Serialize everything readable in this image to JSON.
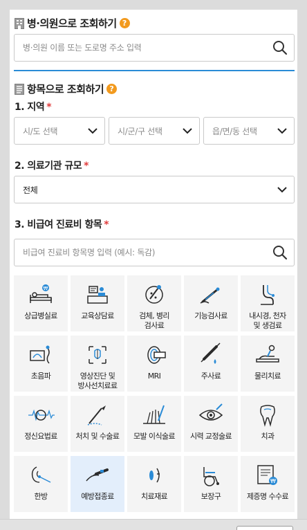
{
  "hospital_search": {
    "title": "병·의원으로 조회하기",
    "placeholder": "병·의원 이름 또는 도로명 주소 입력"
  },
  "item_search": {
    "title": "항목으로 조회하기"
  },
  "region": {
    "label": "1. 지역",
    "required": "*",
    "sido": "시/도 선택",
    "sigungu": "시/군/구 선택",
    "eupmyeondong": "읍/면/동 선택"
  },
  "scale": {
    "label": "2. 의료기관 규모",
    "required": "*",
    "value": "전체"
  },
  "items": {
    "label": "3. 비급여 진료비 항목",
    "required": "*",
    "placeholder": "비급여 진료비 항목명 입력 (예시: 독감)",
    "tiles": [
      {
        "label": "상급병실료",
        "icon": "hospital-bed-icon"
      },
      {
        "label": "교육상담료",
        "icon": "counseling-icon"
      },
      {
        "label": "검체, 병리\n검사료",
        "icon": "microscope-icon"
      },
      {
        "label": "기능검사료",
        "icon": "thermometer-icon"
      },
      {
        "label": "내시경, 천자\n및 생검료",
        "icon": "endoscope-icon"
      },
      {
        "label": "초음파",
        "icon": "ultrasound-icon"
      },
      {
        "label": "영상진단 및\n방사선치료료",
        "icon": "radiology-icon"
      },
      {
        "label": "MRI",
        "icon": "mri-icon"
      },
      {
        "label": "주사료",
        "icon": "syringe-icon"
      },
      {
        "label": "물리치료",
        "icon": "physiotherapy-icon"
      },
      {
        "label": "정신요법료",
        "icon": "brain-wave-icon"
      },
      {
        "label": "처치 및 수술료",
        "icon": "scalpel-icon"
      },
      {
        "label": "모발 이식술료",
        "icon": "hair-transplant-icon"
      },
      {
        "label": "시력 교정술료",
        "icon": "eye-laser-icon"
      },
      {
        "label": "치과",
        "icon": "tooth-icon"
      },
      {
        "label": "한방",
        "icon": "acupuncture-icon"
      },
      {
        "label": "예방접종료",
        "icon": "vaccination-icon"
      },
      {
        "label": "치료재료",
        "icon": "lens-material-icon"
      },
      {
        "label": "보장구",
        "icon": "wheelchair-icon"
      },
      {
        "label": "제증명 수수료",
        "icon": "certificate-icon"
      }
    ]
  },
  "colors": {
    "accent": "#2a8bd6",
    "help": "#f29a1e",
    "required": "#e03c3c",
    "selected_tile": "#e3eefb"
  }
}
